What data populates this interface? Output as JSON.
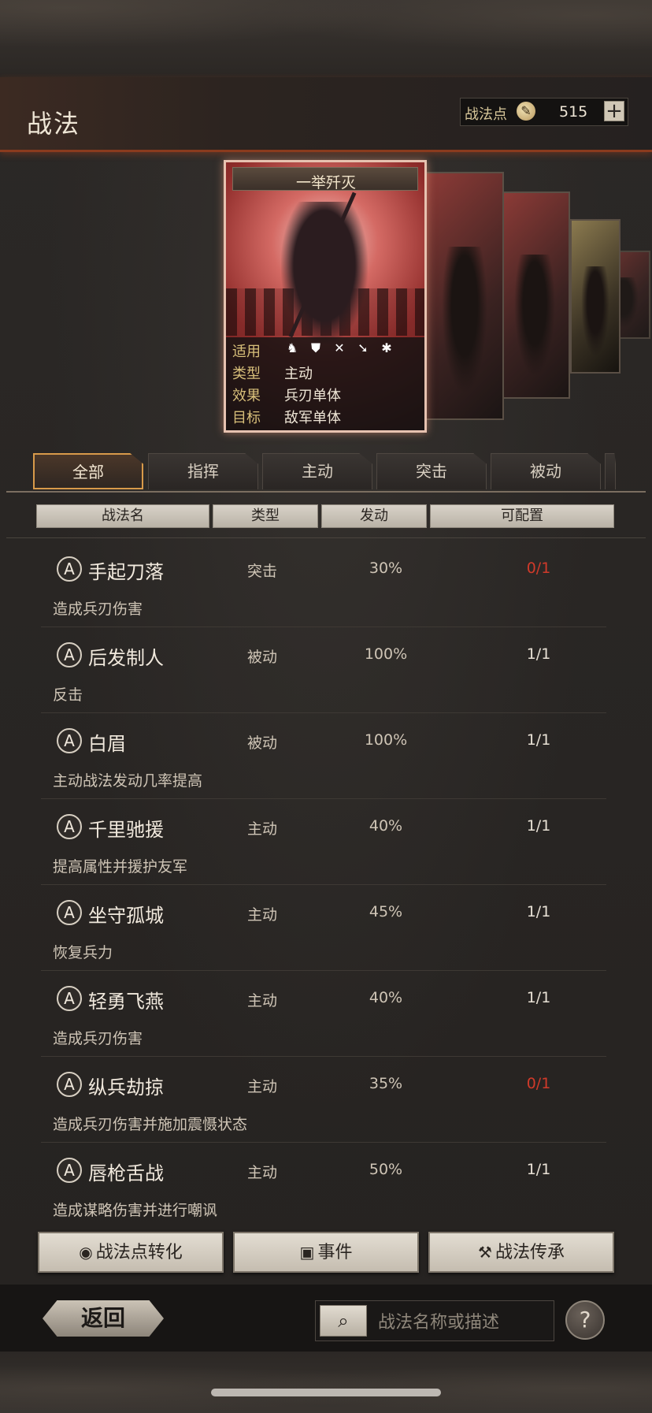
{
  "header": {
    "title": "战法",
    "points_label": "战法点",
    "points_value": "515",
    "plus_label": "+"
  },
  "card": {
    "name": "一举歼灭",
    "rows": [
      {
        "key": "适用",
        "value": ""
      },
      {
        "key": "类型",
        "value": "主动"
      },
      {
        "key": "效果",
        "value": "兵刃单体"
      },
      {
        "key": "目标",
        "value": "敌军单体"
      }
    ],
    "unit_icons": [
      "cavalry-icon",
      "shield-icon",
      "bow-icon",
      "spear-icon",
      "wheel-icon"
    ]
  },
  "tabs": [
    {
      "label": "全部",
      "active": true
    },
    {
      "label": "指挥",
      "active": false
    },
    {
      "label": "主动",
      "active": false
    },
    {
      "label": "突击",
      "active": false
    },
    {
      "label": "被动",
      "active": false
    }
  ],
  "columns": [
    "战法名",
    "类型",
    "发动",
    "可配置"
  ],
  "tactics": [
    {
      "grade": "A",
      "name": "手起刀落",
      "type": "突击",
      "rate": "30%",
      "available": "0/1",
      "desc": "造成兵刃伤害",
      "warn": true
    },
    {
      "grade": "A",
      "name": "后发制人",
      "type": "被动",
      "rate": "100%",
      "available": "1/1",
      "desc": "反击",
      "warn": false
    },
    {
      "grade": "A",
      "name": "白眉",
      "type": "被动",
      "rate": "100%",
      "available": "1/1",
      "desc": "主动战法发动几率提高",
      "warn": false
    },
    {
      "grade": "A",
      "name": "千里驰援",
      "type": "主动",
      "rate": "40%",
      "available": "1/1",
      "desc": "提高属性并援护友军",
      "warn": false
    },
    {
      "grade": "A",
      "name": "坐守孤城",
      "type": "主动",
      "rate": "45%",
      "available": "1/1",
      "desc": "恢复兵力",
      "warn": false
    },
    {
      "grade": "A",
      "name": "轻勇飞燕",
      "type": "主动",
      "rate": "40%",
      "available": "1/1",
      "desc": "造成兵刃伤害",
      "warn": false
    },
    {
      "grade": "A",
      "name": "纵兵劫掠",
      "type": "主动",
      "rate": "35%",
      "available": "0/1",
      "desc": "造成兵刃伤害并施加震慑状态",
      "warn": true
    },
    {
      "grade": "A",
      "name": "唇枪舌战",
      "type": "主动",
      "rate": "50%",
      "available": "1/1",
      "desc": "造成谋略伤害并进行嘲讽",
      "warn": false
    }
  ],
  "actions": {
    "convert": "战法点转化",
    "events": "事件",
    "inherit": "战法传承"
  },
  "footer": {
    "back": "返回",
    "search_placeholder": "战法名称或描述",
    "help": "?"
  },
  "colors": {
    "accent_orange": "#d89a4a",
    "warn_red": "#d03a2a"
  }
}
